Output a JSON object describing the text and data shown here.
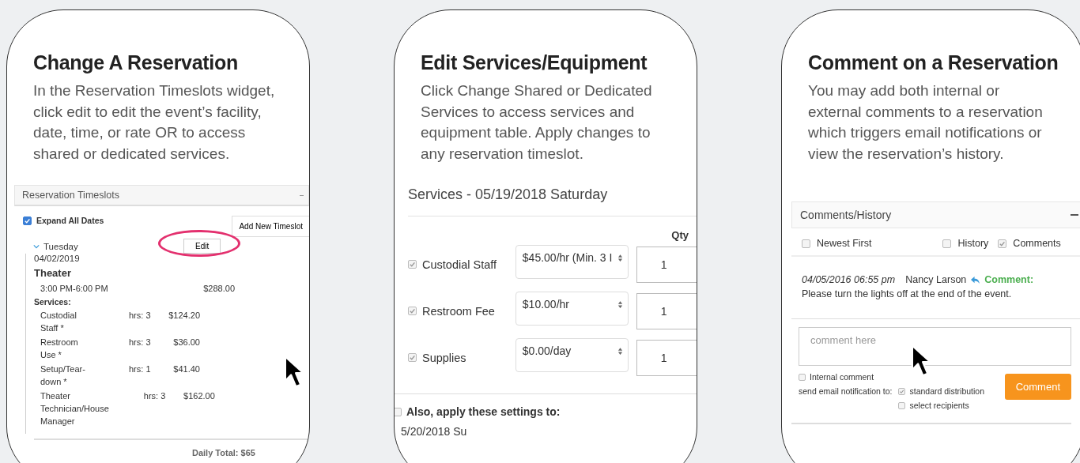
{
  "cards": [
    {
      "kind": "timeslots",
      "title": "Change A Reservation",
      "description": [
        "In the Reservation Timeslots widget,",
        "click edit to edit the event’s facility,",
        "date, time, or rate OR to access",
        "shared or dedicated services."
      ]
    },
    {
      "kind": "services",
      "title": "Edit Services/Equipment",
      "description": [
        "Click Change Shared or Dedicated",
        "Services to access services and",
        "equipment table. Apply changes to",
        "any reservation timeslot."
      ]
    },
    {
      "kind": "comments",
      "title": "Comment on a Reservation",
      "description": [
        "You may add both internal or",
        "external comments to a reservation",
        "which triggers email notifications or",
        "view the reservation’s history."
      ]
    }
  ],
  "timeslots": {
    "title": "Reservation Timeslots",
    "expand_all": {
      "label": "Expand All Dates",
      "checked": true
    },
    "add_button": "Add New Timeslot",
    "day": {
      "label": "Tuesday",
      "expanded": true,
      "date": "04/02/2019",
      "edit_button": "Edit",
      "facility": "Theater",
      "time": "3:00 PM-6:00 PM",
      "price": "$288.00",
      "services_label": "Services:"
    },
    "services": [
      {
        "name": "Custodial Staff *",
        "hours": "hrs: 3",
        "price": "$124.20"
      },
      {
        "name": "Restroom Use *",
        "hours": "hrs: 3",
        "price": "$36.00"
      },
      {
        "name": "Setup/Tear-down *",
        "hours": "hrs: 1",
        "price": "$41.40"
      },
      {
        "name": "Theater Technician/House Manager",
        "hours": "hrs: 3",
        "price": "$162.00"
      }
    ],
    "daily_total": "Daily Total: $65"
  },
  "services": {
    "title": "Services - 05/19/2018 Saturday",
    "qty_header": "Qty",
    "items": [
      {
        "name": "Custodial Staff",
        "checked": true,
        "rate": "$45.00/hr (Min. 3 I",
        "qty": "1"
      },
      {
        "name": "Restroom Fee",
        "checked": true,
        "rate": "$10.00/hr",
        "qty": "1"
      },
      {
        "name": "Supplies",
        "checked": true,
        "rate": "$0.00/day",
        "qty": "1"
      }
    ],
    "apply": {
      "label": "Also, apply these settings to:",
      "checked": false
    },
    "dates": [
      "5/20/2018 Su"
    ]
  },
  "comments": {
    "title": "Comments/History",
    "filters": [
      {
        "label": "Newest First",
        "checked": false
      },
      {
        "label": "History",
        "checked": false
      },
      {
        "label": "Comments",
        "checked": true
      }
    ],
    "entry": {
      "timestamp": "04/05/2016 06:55 pm",
      "author": "Nancy Larson",
      "type_label": "Comment:",
      "text": "Please turn the lights off at the end of the event."
    },
    "input": {
      "placeholder": "comment here"
    },
    "internal": {
      "label": "Internal comment",
      "checked": false
    },
    "notify_label": "send email notification to:",
    "notify_options": [
      {
        "label": "standard distribution",
        "checked": true
      },
      {
        "label": "select recipients",
        "checked": false
      }
    ],
    "submit": "Comment"
  }
}
